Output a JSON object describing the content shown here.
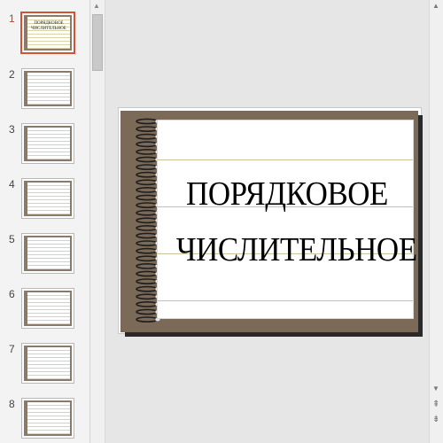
{
  "slides": [
    {
      "number": "1",
      "title": "ПОРЯДКОВОЕ ЧИСЛИТЕЛЬНОЕ",
      "active": true
    },
    {
      "number": "2"
    },
    {
      "number": "3"
    },
    {
      "number": "4"
    },
    {
      "number": "5"
    },
    {
      "number": "6"
    },
    {
      "number": "7"
    },
    {
      "number": "8"
    }
  ],
  "main_slide": {
    "title_line1": "ПОРЯДКОВОЕ",
    "title_line2": "ЧИСЛИТЕЛЬНОЕ"
  },
  "scrollbar": {
    "up_icon": "▲",
    "down_icon": "▼",
    "prev_slide_icon": "⇞",
    "next_slide_icon": "⇟"
  },
  "colors": {
    "active_thumb_border": "#d35230",
    "notebook_cover": "#7b6a58",
    "ruling_line": "#c9c49a"
  }
}
